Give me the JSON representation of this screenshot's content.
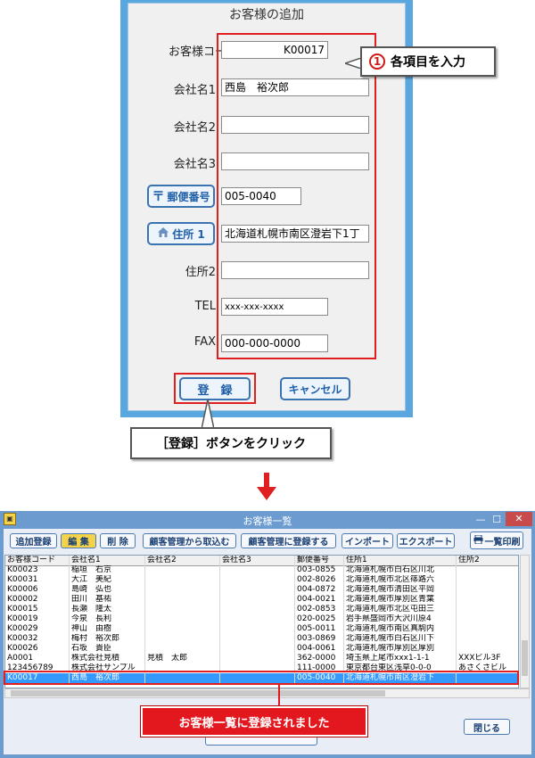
{
  "dialog": {
    "title": "お客様の追加",
    "labels": {
      "customer_code": "お客様コード",
      "company1": "会社名1",
      "company2": "会社名2",
      "company3": "会社名3",
      "postal_button": "郵便番号",
      "address1_button": "住所 1",
      "address2": "住所2",
      "tel": "TEL",
      "fax": "FAX"
    },
    "values": {
      "customer_code": "K00017",
      "company1": "西島　裕次郎",
      "company2": "",
      "company3": "",
      "postal": "005-0040",
      "address1": "北海道札幌市南区澄岩下1丁",
      "address2": "",
      "tel": "xxx-xxx-xxxx",
      "fax": "000-000-0000"
    },
    "register_button": "登　録",
    "cancel_button": "キャンセル"
  },
  "callouts": {
    "step_number": "1",
    "step_text": "各項目を入力",
    "register_hint": "［登録］ボタンをクリック",
    "result": "お客様一覧に登録されました"
  },
  "window": {
    "title": "お客様一覧",
    "toolbar": [
      "追加登録",
      "編 集",
      "削 除",
      "顧客管理から取込む",
      "顧客管理に登録する",
      "インポート",
      "エクスポート"
    ],
    "print_button": "一覧印刷",
    "close_button": "閉じる",
    "columns": [
      "お客様コード",
      "会社名1",
      "会社名2",
      "会社名3",
      "郵便番号",
      "住所1",
      "住所2"
    ],
    "rows": [
      [
        "K00023",
        "稲垣　右京",
        "",
        "",
        "003-0855",
        "北海道札幌市白石区川北",
        ""
      ],
      [
        "K00031",
        "大江　美紀",
        "",
        "",
        "002-8026",
        "北海道札幌市北区篠路六",
        ""
      ],
      [
        "K00006",
        "島崎　弘也",
        "",
        "",
        "004-0872",
        "北海道札幌市清田区平岡",
        ""
      ],
      [
        "K00002",
        "田川　基祐",
        "",
        "",
        "004-0021",
        "北海道札幌市厚別区青葉",
        ""
      ],
      [
        "K00015",
        "長瀬　隆太",
        "",
        "",
        "002-0853",
        "北海道札幌市北区屯田三",
        ""
      ],
      [
        "K00019",
        "今泉　長利",
        "",
        "",
        "020-0025",
        "岩手県盛岡市大沢川原4",
        ""
      ],
      [
        "K00029",
        "神山　由樹",
        "",
        "",
        "005-0011",
        "北海道札幌市南区真駒内",
        ""
      ],
      [
        "K00032",
        "梅村　裕次郎",
        "",
        "",
        "003-0869",
        "北海道札幌市白石区川下",
        ""
      ],
      [
        "K00026",
        "石坂　貴臣",
        "",
        "",
        "004-0061",
        "北海道札幌市厚別区厚別",
        ""
      ],
      [
        "A0001",
        "株式会社見積",
        "見積　太郎",
        "",
        "362-0000",
        "埼玉県上尾市xxx1-1-1",
        "XXXビル3F"
      ],
      [
        "123456789",
        "株式会社サンプル",
        "",
        "",
        "111-0000",
        "東京都台東区浅草0-0-0",
        "あさくさビル"
      ],
      [
        "K00017",
        "西島　裕次郎",
        "",
        "",
        "005-0040",
        "北海道札幌市南区澄岩下",
        ""
      ]
    ]
  },
  "colors": {
    "dialog_frame": "#5aa6de",
    "accent_red": "#e02020",
    "button_blue": "#3b73b0",
    "selection": "#3399ff",
    "window_frame": "#6c9bd0"
  }
}
